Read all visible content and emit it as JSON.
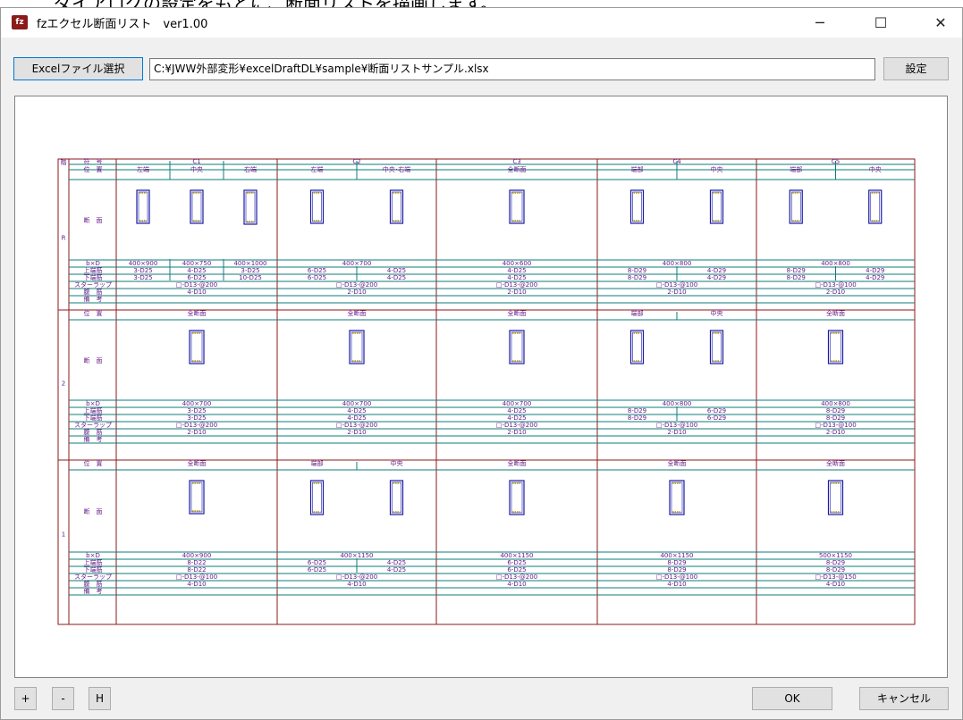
{
  "window": {
    "title": "fzエクセル断面リスト　ver1.00",
    "app_icon": "building-app-icon",
    "top_caption": "ダイアログの設定をもとに、断面リストを描画します。"
  },
  "controls": {
    "minimize": "─",
    "maximize": "☐",
    "close": "✕"
  },
  "toolbar": {
    "select_file_label": "Excelファイル選択",
    "file_path": "C:¥JWW外部変形¥excelDraftDL¥sample¥断面リストサンプル.xlsx",
    "settings_label": "設定"
  },
  "footer": {
    "zoom_in_label": "+",
    "zoom_out_label": "-",
    "home_label": "H",
    "ok_label": "OK",
    "cancel_label": "キャンセル"
  },
  "drawing": {
    "colors": {
      "frame": "#8b1a1a",
      "line": "#0f7b7b",
      "text": "#6a1b8a",
      "section": "#1a1aa6",
      "rebar": "#b89a00"
    },
    "row_labels": {
      "mark": "符　号",
      "position": "位　置",
      "section": "断　面",
      "bxd": "b×D",
      "top_bar": "上端筋",
      "bottom_bar": "下端筋",
      "stirrup": "スターラップ",
      "web_bar": "腹　筋",
      "remarks": "備　考"
    },
    "corner_label": "階",
    "columns": [
      "C1",
      "C2",
      "C3",
      "C4",
      "C5"
    ],
    "floors": [
      {
        "label": "R",
        "cells": [
          {
            "positions": [
              "左端",
              "中央",
              "右端"
            ],
            "bxd": [
              "400×900",
              "400×750",
              "400×1000"
            ],
            "top": [
              "3-D25",
              "4-D25",
              "3-D25"
            ],
            "bottom": [
              "3-D25",
              "6-D25",
              "10-D25"
            ],
            "stirrup": "□-D13-@200",
            "web": "4-D10"
          },
          {
            "positions": [
              "左端",
              "中央･右端"
            ],
            "bxd": [
              "400×700"
            ],
            "top": [
              "6-D25",
              "4-D25"
            ],
            "bottom": [
              "6-D25",
              "4-D25"
            ],
            "stirrup": "□-D13-@200",
            "web": "2-D10"
          },
          {
            "positions": [
              "全断面"
            ],
            "bxd": [
              "400×600"
            ],
            "top": [
              "4-D25"
            ],
            "bottom": [
              "4-D25"
            ],
            "stirrup": "□-D13-@200",
            "web": "2-D10"
          },
          {
            "positions": [
              "端部",
              "中央"
            ],
            "bxd": [
              "400×800"
            ],
            "top": [
              "8-D29",
              "4-D29"
            ],
            "bottom": [
              "8-D29",
              "4-D29"
            ],
            "stirrup": "□-D13-@100",
            "web": "2-D10"
          },
          {
            "positions": [
              "端部",
              "中央"
            ],
            "bxd": [
              "400×800"
            ],
            "top": [
              "8-D29",
              "4-D29"
            ],
            "bottom": [
              "8-D29",
              "4-D29"
            ],
            "stirrup": "□-D13-@100",
            "web": "2-D10"
          }
        ]
      },
      {
        "label": "2",
        "cells": [
          {
            "positions": [
              "全断面"
            ],
            "bxd": [
              "400×700"
            ],
            "top": [
              "3-D25"
            ],
            "bottom": [
              "3-D25"
            ],
            "stirrup": "□-D13-@200",
            "web": "2-D10"
          },
          {
            "positions": [
              "全断面"
            ],
            "bxd": [
              "400×700"
            ],
            "top": [
              "4-D25"
            ],
            "bottom": [
              "4-D25"
            ],
            "stirrup": "□-D13-@200",
            "web": "2-D10"
          },
          {
            "positions": [
              "全断面"
            ],
            "bxd": [
              "400×700"
            ],
            "top": [
              "4-D25"
            ],
            "bottom": [
              "4-D25"
            ],
            "stirrup": "□-D13-@200",
            "web": "2-D10"
          },
          {
            "positions": [
              "端部",
              "中央"
            ],
            "bxd": [
              "400×800"
            ],
            "top": [
              "8-D29",
              "6-D29"
            ],
            "bottom": [
              "8-D29",
              "6-D29"
            ],
            "stirrup": "□-D13-@100",
            "web": "2-D10"
          },
          {
            "positions": [
              "全断面"
            ],
            "bxd": [
              "400×800"
            ],
            "top": [
              "8-D29"
            ],
            "bottom": [
              "8-D29"
            ],
            "stirrup": "□-D13-@100",
            "web": "2-D10"
          }
        ]
      },
      {
        "label": "1",
        "cells": [
          {
            "positions": [
              "全断面"
            ],
            "bxd": [
              "400×900"
            ],
            "top": [
              "8-D22"
            ],
            "bottom": [
              "8-D22"
            ],
            "stirrup": "□-D13-@100",
            "web": "4-D10"
          },
          {
            "positions": [
              "端部",
              "中央"
            ],
            "bxd": [
              "400×1150"
            ],
            "top": [
              "6-D25",
              "4-D25"
            ],
            "bottom": [
              "6-D25",
              "4-D25"
            ],
            "stirrup": "□-D13-@200",
            "web": "4-D10"
          },
          {
            "positions": [
              "全断面"
            ],
            "bxd": [
              "400×1150"
            ],
            "top": [
              "6-D25"
            ],
            "bottom": [
              "6-D25"
            ],
            "stirrup": "□-D13-@200",
            "web": "4-D10"
          },
          {
            "positions": [
              "全断面"
            ],
            "bxd": [
              "400×1150"
            ],
            "top": [
              "8-D29"
            ],
            "bottom": [
              "8-D29"
            ],
            "stirrup": "□-D13-@100",
            "web": "4-D10"
          },
          {
            "positions": [
              "全断面"
            ],
            "bxd": [
              "500×1150"
            ],
            "top": [
              "8-D29"
            ],
            "bottom": [
              "8-D29"
            ],
            "stirrup": "□-D13-@150",
            "web": "4-D10"
          }
        ]
      }
    ]
  }
}
